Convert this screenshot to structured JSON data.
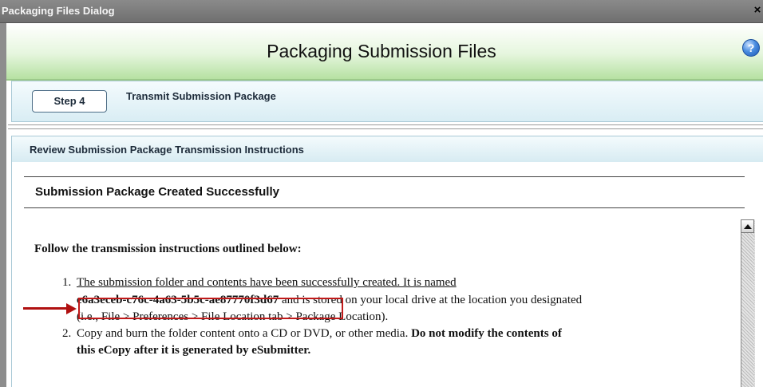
{
  "window": {
    "title": "Packaging Files Dialog",
    "close_glyph": "×"
  },
  "header": {
    "title": "Packaging Submission Files",
    "help_glyph": "?"
  },
  "step": {
    "button_label": "Step 4",
    "label": "Transmit Submission Package"
  },
  "review": {
    "label": "Review Submission Package Transmission Instructions"
  },
  "content": {
    "heading": "Submission Package Created Successfully",
    "intro": "Follow the transmission instructions outlined below:",
    "item1": {
      "number": "1.",
      "line1": "The submission folder and contents have been successfully created. It is named",
      "guid": "e6a3eceb-c76c-4a63-5b5c-ae87770f3d67",
      "line2_rest": " and is stored on your local drive at the location you designated",
      "line3": "(i.e., File > Preferences > File Location tab > Package Location)."
    },
    "item2": {
      "number": "2.",
      "line1_normal": "Copy and burn the folder content onto a CD or DVD, or other media. ",
      "line1_bold": "Do not modify the contents of",
      "line2_bold": "this eCopy after it is generated by eSubmitter."
    }
  },
  "colors": {
    "titlebar": "#7a7a7a",
    "header_green": "#b6e1a2",
    "step_band": "#d9edf4",
    "highlight_red": "#c01a1a"
  },
  "icons": {
    "help": "help-icon",
    "close": "close-icon",
    "annotation_arrow": "arrow-right-icon",
    "scroll_up": "scroll-up-arrow-icon"
  }
}
